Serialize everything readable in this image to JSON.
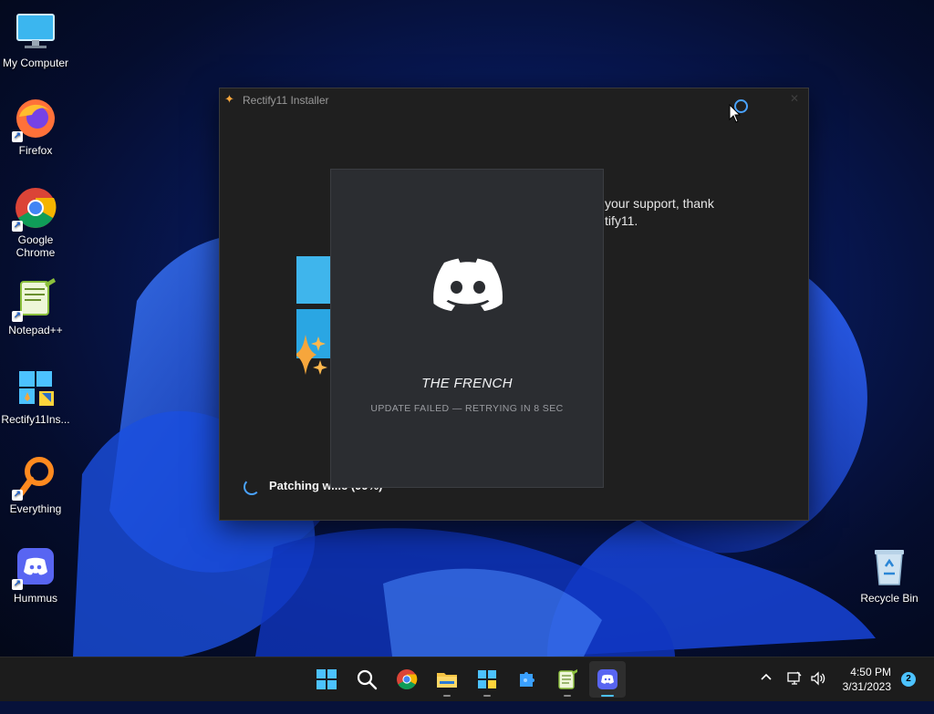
{
  "desktop": {
    "icons": [
      {
        "label": "My Computer",
        "icon": "monitor-icon"
      },
      {
        "label": "Firefox",
        "icon": "firefox-icon"
      },
      {
        "label": "Google Chrome",
        "icon": "chrome-icon"
      },
      {
        "label": "Notepad++",
        "icon": "notepadpp-icon"
      },
      {
        "label": "Rectify11Ins...",
        "icon": "rectify11-installer-icon"
      },
      {
        "label": "Everything",
        "icon": "everything-search-icon"
      },
      {
        "label": "Hummus",
        "icon": "discord-icon"
      },
      {
        "label": "Recycle Bin",
        "icon": "recycle-bin-icon"
      }
    ]
  },
  "installer": {
    "title": "Rectify11 Installer",
    "support_line1": "your support, thank",
    "support_line2": "tify11.",
    "patching_text": "Patching w...e (99%)"
  },
  "discord_splash": {
    "username": "THE FRENCH",
    "status": "UPDATE FAILED — RETRYING IN 8 SEC"
  },
  "taskbar": {
    "apps": [
      "start-icon",
      "search-icon",
      "chrome-icon",
      "file-explorer-icon",
      "rectify11-icon",
      "puzzle-app-icon",
      "notepadpp-icon",
      "discord-icon"
    ],
    "clock_time": "4:50 PM",
    "clock_date": "3/31/2023",
    "notification_count": "2"
  },
  "colors": {
    "accent": "#4cc2ff",
    "discord_blurple": "#5865f2",
    "window_bg": "#1f1f1f",
    "discord_bg": "#2b2d31"
  }
}
